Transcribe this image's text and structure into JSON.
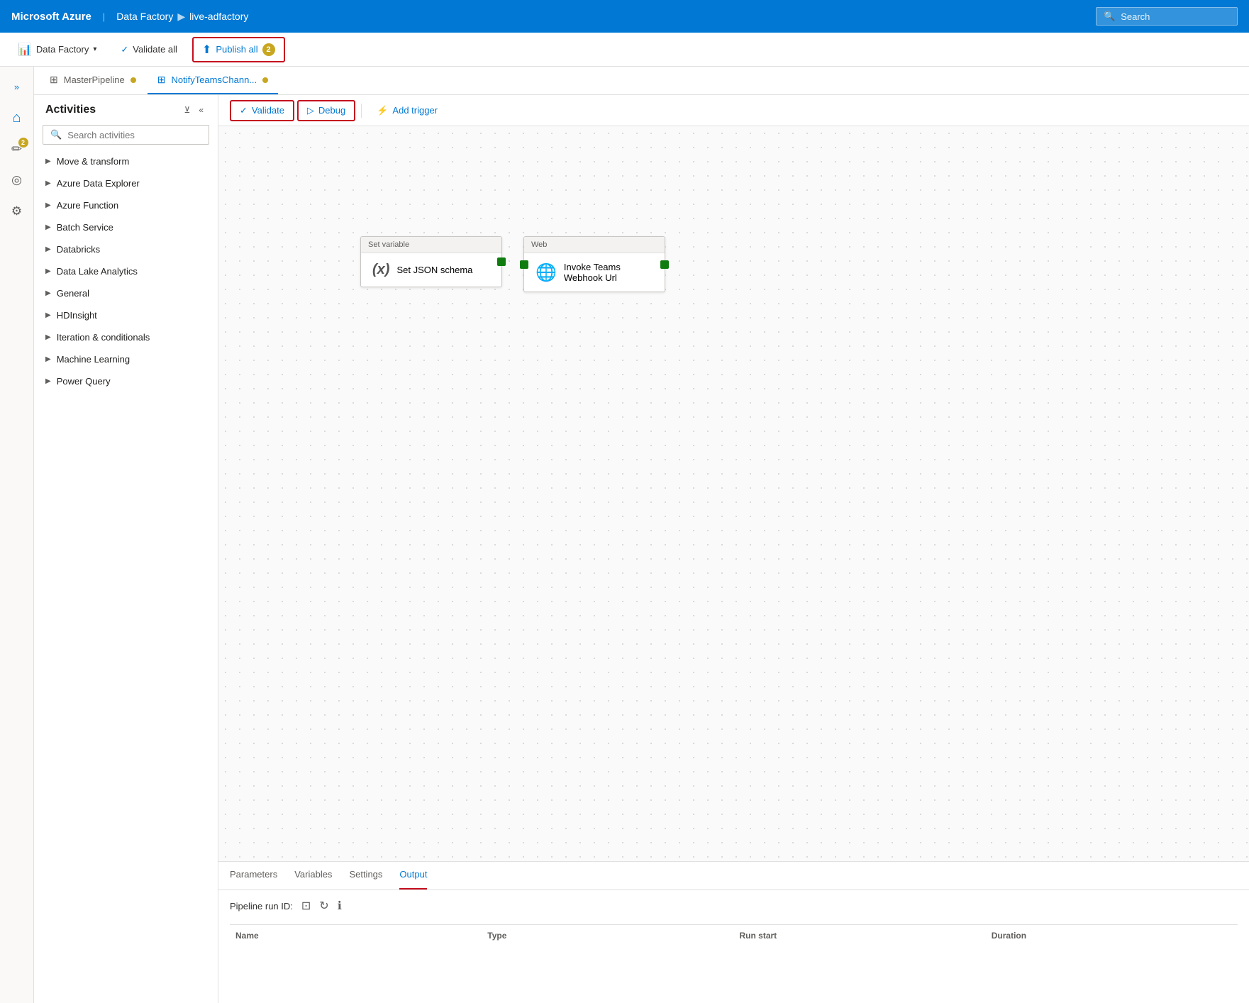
{
  "topNav": {
    "brand": "Microsoft Azure",
    "separator": "|",
    "breadcrumbs": [
      "Data Factory",
      "live-adfactory"
    ],
    "searchPlaceholder": "Search"
  },
  "toolbar": {
    "dataFactory": "Data Factory",
    "validateAll": "Validate all",
    "publishAll": "Publish all",
    "publishBadge": "2"
  },
  "tabs": [
    {
      "id": "master",
      "icon": "⊞",
      "label": "MasterPipeline",
      "dot": true
    },
    {
      "id": "notify",
      "icon": "⊞",
      "label": "NotifyTeamsChann...",
      "dot": true
    }
  ],
  "activities": {
    "title": "Activities",
    "searchPlaceholder": "Search activities",
    "groups": [
      {
        "label": "Move & transform"
      },
      {
        "label": "Azure Data Explorer"
      },
      {
        "label": "Azure Function"
      },
      {
        "label": "Batch Service"
      },
      {
        "label": "Databricks"
      },
      {
        "label": "Data Lake Analytics"
      },
      {
        "label": "General"
      },
      {
        "label": "HDInsight"
      },
      {
        "label": "Iteration & conditionals"
      },
      {
        "label": "Machine Learning"
      },
      {
        "label": "Power Query"
      }
    ]
  },
  "canvasToolbar": {
    "validate": "Validate",
    "debug": "Debug",
    "addTrigger": "Add trigger"
  },
  "nodes": {
    "setVariable": {
      "header": "Set variable",
      "icon": "(x)",
      "label": "Set JSON schema"
    },
    "web": {
      "header": "Web",
      "icon": "🌐",
      "label": "Invoke Teams\nWebhook Url"
    }
  },
  "bottomPanel": {
    "tabs": [
      "Parameters",
      "Variables",
      "Settings",
      "Output"
    ],
    "activeTab": "Output",
    "pipelineRunId": "Pipeline run ID:",
    "tableHeaders": [
      "Name",
      "Type",
      "Run start",
      "Duration"
    ]
  },
  "sidebarIcons": [
    {
      "id": "home",
      "icon": "⌂",
      "active": true
    },
    {
      "id": "edit",
      "icon": "✏",
      "badge": "2"
    },
    {
      "id": "monitor",
      "icon": "◎"
    },
    {
      "id": "manage",
      "icon": "🧰"
    }
  ]
}
